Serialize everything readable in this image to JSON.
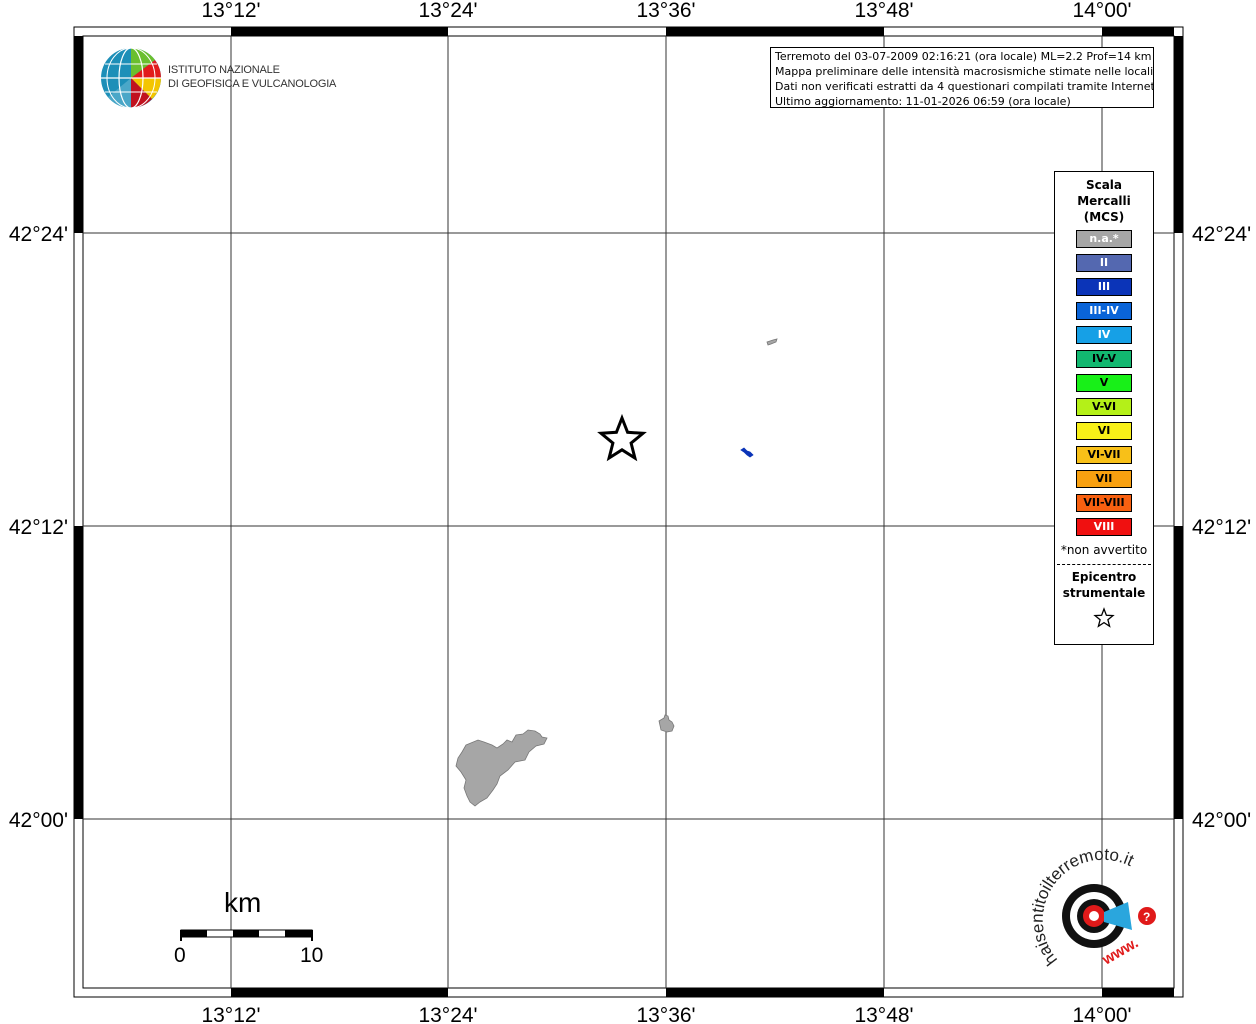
{
  "map": {
    "lon_ticks": [
      "13°12'",
      "13°24'",
      "13°36'",
      "13°48'",
      "14°00'"
    ],
    "lat_ticks": [
      "42°24'",
      "42°12'",
      "42°00'"
    ]
  },
  "info": {
    "line1": "Terremoto del 03-07-2009 02:16:21 (ora locale) ML=2.2 Prof=14 km",
    "line2": "Mappa preliminare delle intensità macrosismiche stimate nelle località",
    "line3": "Dati non verificati estratti da 4 questionari compilati tramite Internet.",
    "line4": "Ultimo aggiornamento: 11-01-2026 06:59 (ora locale)"
  },
  "legend": {
    "title_line1": "Scala",
    "title_line2": "Mercalli",
    "title_line3": "(MCS)",
    "items": [
      {
        "label": "n.a.*",
        "color": "#a6a6a6",
        "text": "#ffffff"
      },
      {
        "label": "II",
        "color": "#5468b0",
        "text": "#ffffff"
      },
      {
        "label": "III",
        "color": "#0b34b8",
        "text": "#ffffff"
      },
      {
        "label": "III-IV",
        "color": "#0a64d8",
        "text": "#ffffff"
      },
      {
        "label": "IV",
        "color": "#16a0e6",
        "text": "#ffffff"
      },
      {
        "label": "IV-V",
        "color": "#12b870",
        "text": "#000000"
      },
      {
        "label": "V",
        "color": "#18f018",
        "text": "#000000"
      },
      {
        "label": "V-VI",
        "color": "#b4f018",
        "text": "#000000"
      },
      {
        "label": "VI",
        "color": "#f8f018",
        "text": "#000000"
      },
      {
        "label": "VI-VII",
        "color": "#f8c018",
        "text": "#000000"
      },
      {
        "label": "VII",
        "color": "#f8a010",
        "text": "#000000"
      },
      {
        "label": "VII-VIII",
        "color": "#f86010",
        "text": "#000000"
      },
      {
        "label": "VIII",
        "color": "#f01010",
        "text": "#ffffff"
      }
    ],
    "note": "*non avvertito",
    "epicenter_line1": "Epicentro",
    "epicenter_line2": "strumentale"
  },
  "logo": {
    "line1": "ISTITUTO NAZIONALE",
    "line2": "DI GEOFISICA E VULCANOLOGIA"
  },
  "haisentito": {
    "text": "haisentitoilterremoto.it",
    "www": "www."
  },
  "scalebar": {
    "unit": "km",
    "min_label": "0",
    "max_label": "10"
  },
  "colors": {
    "na_gray": "#a6a6a6",
    "intensity_iii": "#0b34b8"
  }
}
